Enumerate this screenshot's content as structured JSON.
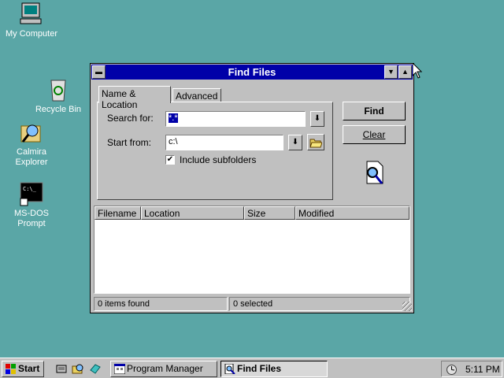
{
  "desktop": {
    "icons": [
      {
        "label": "My Computer",
        "icon": "computer-icon"
      },
      {
        "label": "Recycle Bin",
        "icon": "recycle-bin-icon"
      },
      {
        "label": "Calmira Explorer",
        "icon": "explorer-icon"
      },
      {
        "label": "MS-DOS Prompt",
        "icon": "dos-prompt-icon"
      }
    ]
  },
  "window": {
    "title": "Find Files",
    "tabs": [
      "Name & Location",
      "Advanced"
    ],
    "active_tab": 0,
    "search_for": {
      "label": "Search for:",
      "value": "*.*"
    },
    "start_from": {
      "label": "Start from:",
      "value": "c:\\"
    },
    "include_subfolders": {
      "label": "Include subfolders",
      "checked": true
    },
    "buttons": {
      "find": "Find",
      "clear": "Clear"
    },
    "columns": [
      "Filename",
      "Location",
      "Size",
      "Modified"
    ],
    "status": {
      "found": "0 items found",
      "selected": "0 selected"
    }
  },
  "taskbar": {
    "start_label": "Start",
    "quicklaunch": [
      "dos-icon",
      "explorer-icon",
      "display-icon"
    ],
    "tasks": [
      {
        "label": "Program Manager",
        "active": false
      },
      {
        "label": "Find Files",
        "active": true
      }
    ],
    "clock": "5:11 PM"
  },
  "colors": {
    "desktop": "#5aa6a6",
    "titlebar": "#0000a8",
    "face": "#c0c0c0"
  }
}
